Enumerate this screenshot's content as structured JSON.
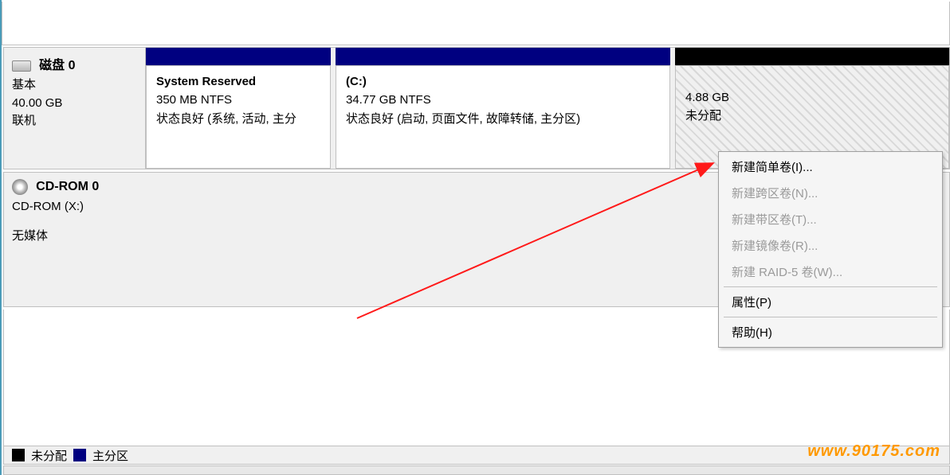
{
  "disk0": {
    "title": "磁盘 0",
    "line1": "基本",
    "line2": "40.00 GB",
    "line3": "联机"
  },
  "partitions": {
    "sysres": {
      "name": "System Reserved",
      "size": "350 MB NTFS",
      "status": "状态良好 (系统, 活动, 主分"
    },
    "c": {
      "name": "(C:)",
      "size": "34.77 GB NTFS",
      "status": "状态良好 (启动, 页面文件, 故障转储, 主分区)"
    },
    "unalloc": {
      "size": "4.88 GB",
      "status": "未分配"
    }
  },
  "cdrom": {
    "title": "CD-ROM 0",
    "drive": "CD-ROM (X:)",
    "media": "无媒体"
  },
  "legend": {
    "unalloc": "未分配",
    "primary": "主分区"
  },
  "context_menu": {
    "simple": "新建简单卷(I)...",
    "span": "新建跨区卷(N)...",
    "stripe": "新建带区卷(T)...",
    "mirror": "新建镜像卷(R)...",
    "raid5": "新建 RAID-5 卷(W)...",
    "properties": "属性(P)",
    "help": "帮助(H)"
  },
  "watermark": "www.90175.com"
}
